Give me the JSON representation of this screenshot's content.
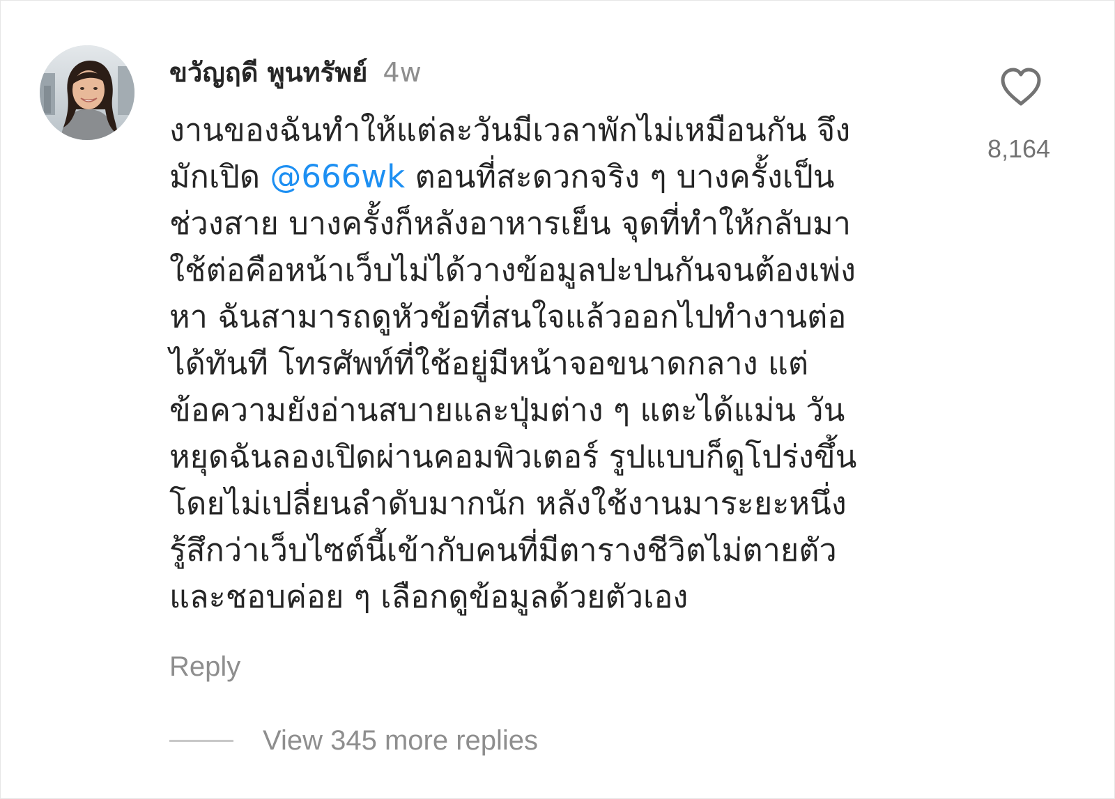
{
  "comment": {
    "author": {
      "username": "ขวัญฤดี พูนทรัพย์",
      "avatar_icon": "user-avatar"
    },
    "timestamp": "4w",
    "body": {
      "lines": [
        {
          "text": "งานของฉันทำให้แต่ละวันมีเวลาพักไม่เหมือนกัน จึง"
        },
        {
          "before": "มักเปิด ",
          "mention": "@666wk",
          "after": " ตอนที่สะดวกจริง ๆ บางครั้งเป็น"
        },
        {
          "text": "ช่วงสาย บางครั้งก็หลังอาหารเย็น จุดที่ทำให้กลับมา"
        },
        {
          "text": "ใช้ต่อคือหน้าเว็บไม่ได้วางข้อมูลปะปนกันจนต้องเพ่ง"
        },
        {
          "text": "หา ฉันสามารถดูหัวข้อที่สนใจแล้วออกไปทำงานต่อ"
        },
        {
          "text": "ได้ทันที โทรศัพท์ที่ใช้อยู่มีหน้าจอขนาดกลาง แต่"
        },
        {
          "text": "ข้อความยังอ่านสบายและปุ่มต่าง ๆ แตะได้แม่น วัน"
        },
        {
          "text": "หยุดฉันลองเปิดผ่านคอมพิวเตอร์ รูปแบบก็ดูโปร่งขึ้น"
        },
        {
          "text": "โดยไม่เปลี่ยนลำดับมากนัก หลังใช้งานมาระยะหนึ่ง"
        },
        {
          "text": "รู้สึกว่าเว็บไซต์นี้เข้ากับคนที่มีตารางชีวิตไม่ตายตัว"
        },
        {
          "text": "และชอบค่อย ๆ เลือกดูข้อมูลด้วยตัวเอง"
        }
      ]
    },
    "likes": {
      "icon": "heart-outline-icon",
      "count": "8,164"
    },
    "reply_label": "Reply",
    "view_replies_label": "View 345 more replies"
  },
  "colors": {
    "mention": "#1d8ff2",
    "text": "#262626",
    "muted": "#8e8e8e"
  }
}
